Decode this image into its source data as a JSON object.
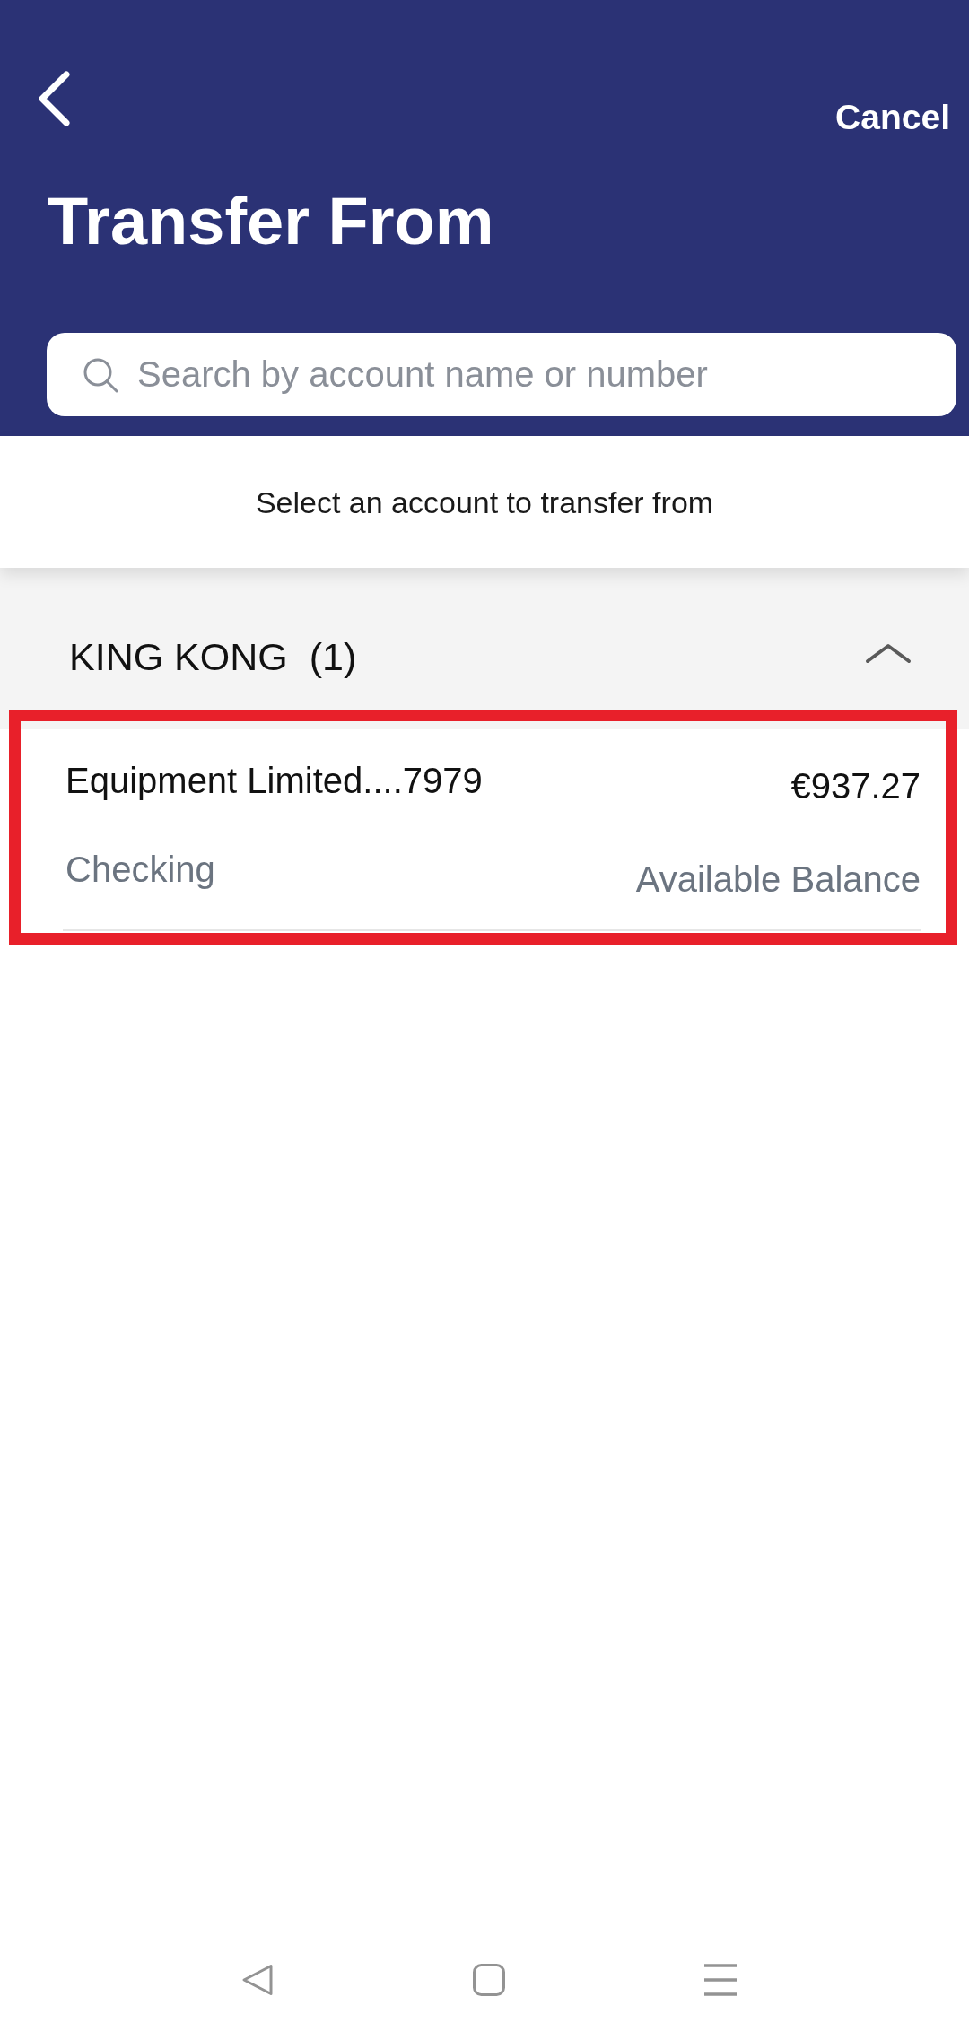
{
  "header": {
    "cancel_label": "Cancel",
    "title": "Transfer From"
  },
  "search": {
    "placeholder": "Search by account name or number"
  },
  "instruction": "Select an account to transfer from",
  "groups": [
    {
      "name": "KING KONG",
      "count": "(1)",
      "expanded": true,
      "accounts": [
        {
          "name": "Equipment Limited....7979",
          "balance": "€937.27",
          "type": "Checking",
          "balance_label": "Available Balance",
          "highlighted": true
        }
      ]
    }
  ]
}
